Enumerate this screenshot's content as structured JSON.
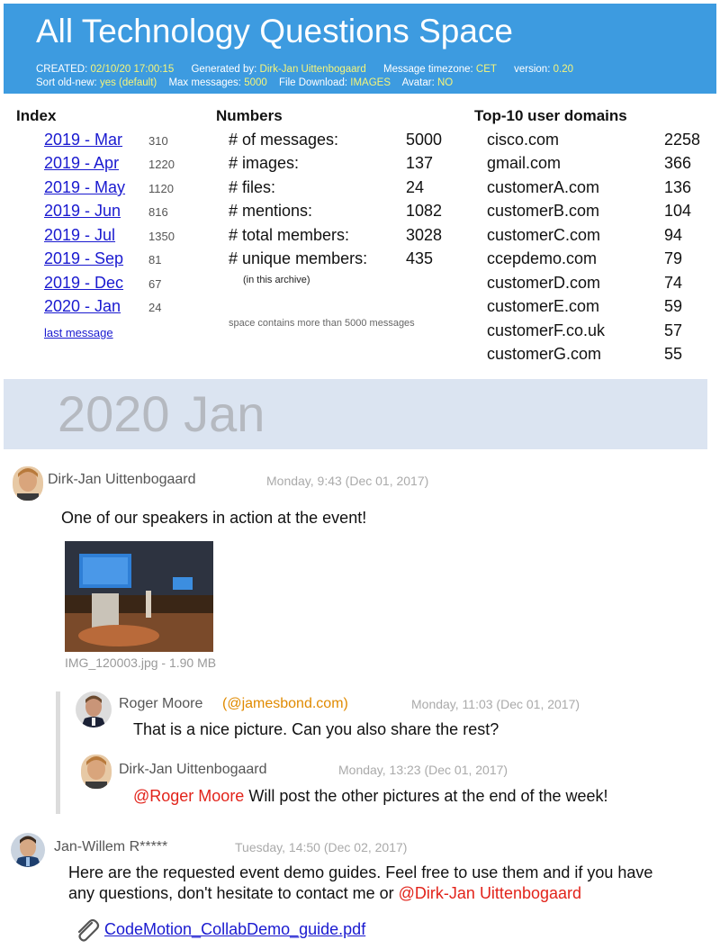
{
  "header": {
    "title": "All Technology Questions Space",
    "created_label": "CREATED:",
    "created_value": "02/10/20 17:00:15",
    "generated_label": "Generated by:",
    "generated_value": "Dirk-Jan Uittenbogaard",
    "timezone_label": "Message timezone:",
    "timezone_value": "CET",
    "version_label": "version:",
    "version_value": "0.20",
    "sort_label": "Sort old-new:",
    "sort_value": "yes (default)",
    "max_label": "Max messages:",
    "max_value": "5000",
    "download_label": "File Download:",
    "download_value": "IMAGES",
    "avatar_label": "Avatar:",
    "avatar_value": "NO"
  },
  "index": {
    "heading": "Index",
    "items": [
      {
        "label": "2019 - Mar",
        "count": "310"
      },
      {
        "label": "2019 - Apr",
        "count": "1220"
      },
      {
        "label": "2019 - May",
        "count": "1120"
      },
      {
        "label": "2019 - Jun",
        "count": "816"
      },
      {
        "label": "2019 - Jul",
        "count": "1350"
      },
      {
        "label": "2019 - Sep",
        "count": "81"
      },
      {
        "label": "2019 - Dec",
        "count": "67"
      },
      {
        "label": "2020 - Jan",
        "count": "24"
      }
    ],
    "last_message": "last message"
  },
  "numbers": {
    "heading": "Numbers",
    "rows": [
      {
        "label": "# of messages:",
        "value": "5000"
      },
      {
        "label": "# images:",
        "value": "137"
      },
      {
        "label": "# files:",
        "value": "24"
      },
      {
        "label": "# mentions:",
        "value": "1082"
      },
      {
        "label": "# total members:",
        "value": "3028"
      },
      {
        "label": "# unique members:",
        "value": "435"
      }
    ],
    "archive_note": "(in this archive)",
    "space_note": "space contains more than 5000 messages"
  },
  "domains": {
    "heading": "Top-10 user domains",
    "rows": [
      {
        "name": "cisco.com",
        "count": "2258"
      },
      {
        "name": "gmail.com",
        "count": "366"
      },
      {
        "name": "customerA.com",
        "count": "136"
      },
      {
        "name": "customerB.com",
        "count": "104"
      },
      {
        "name": "customerC.com",
        "count": "94"
      },
      {
        "name": "ccepdemo.com",
        "count": "79"
      },
      {
        "name": "customerD.com",
        "count": "74"
      },
      {
        "name": "customerE.com",
        "count": "59"
      },
      {
        "name": "customerF.co.uk",
        "count": "57"
      },
      {
        "name": "customerG.com",
        "count": "55"
      }
    ]
  },
  "month_heading": "2020 Jan",
  "messages": {
    "m1": {
      "author": "Dirk-Jan Uittenbogaard",
      "time": "Monday, 9:43 (Dec 01, 2017)",
      "text": "One of our speakers in action at the event!",
      "image_caption": "IMG_120003.jpg - 1.90 MB"
    },
    "r1": {
      "author": "Roger Moore",
      "domain": "(@jamesbond.com)",
      "time": "Monday, 11:03 (Dec 01, 2017)",
      "text": "That is a nice picture. Can you also share the rest?"
    },
    "r2": {
      "author": "Dirk-Jan Uittenbogaard",
      "time": "Monday, 13:23 (Dec 01, 2017)",
      "mention": "@Roger Moore",
      "text": " Will post the other pictures at the end of the week!"
    },
    "m2": {
      "author": "Jan-Willem R*****",
      "time": "Tuesday, 14:50 (Dec 02, 2017)",
      "line1": "Here are the requested event demo guides. Feel free to use them and if you have",
      "line2": "any questions, don't hesitate to contact me or ",
      "mention": "@Dirk-Jan Uittenbogaard",
      "attachment": "CodeMotion_CollabDemo_guide.pdf"
    }
  }
}
